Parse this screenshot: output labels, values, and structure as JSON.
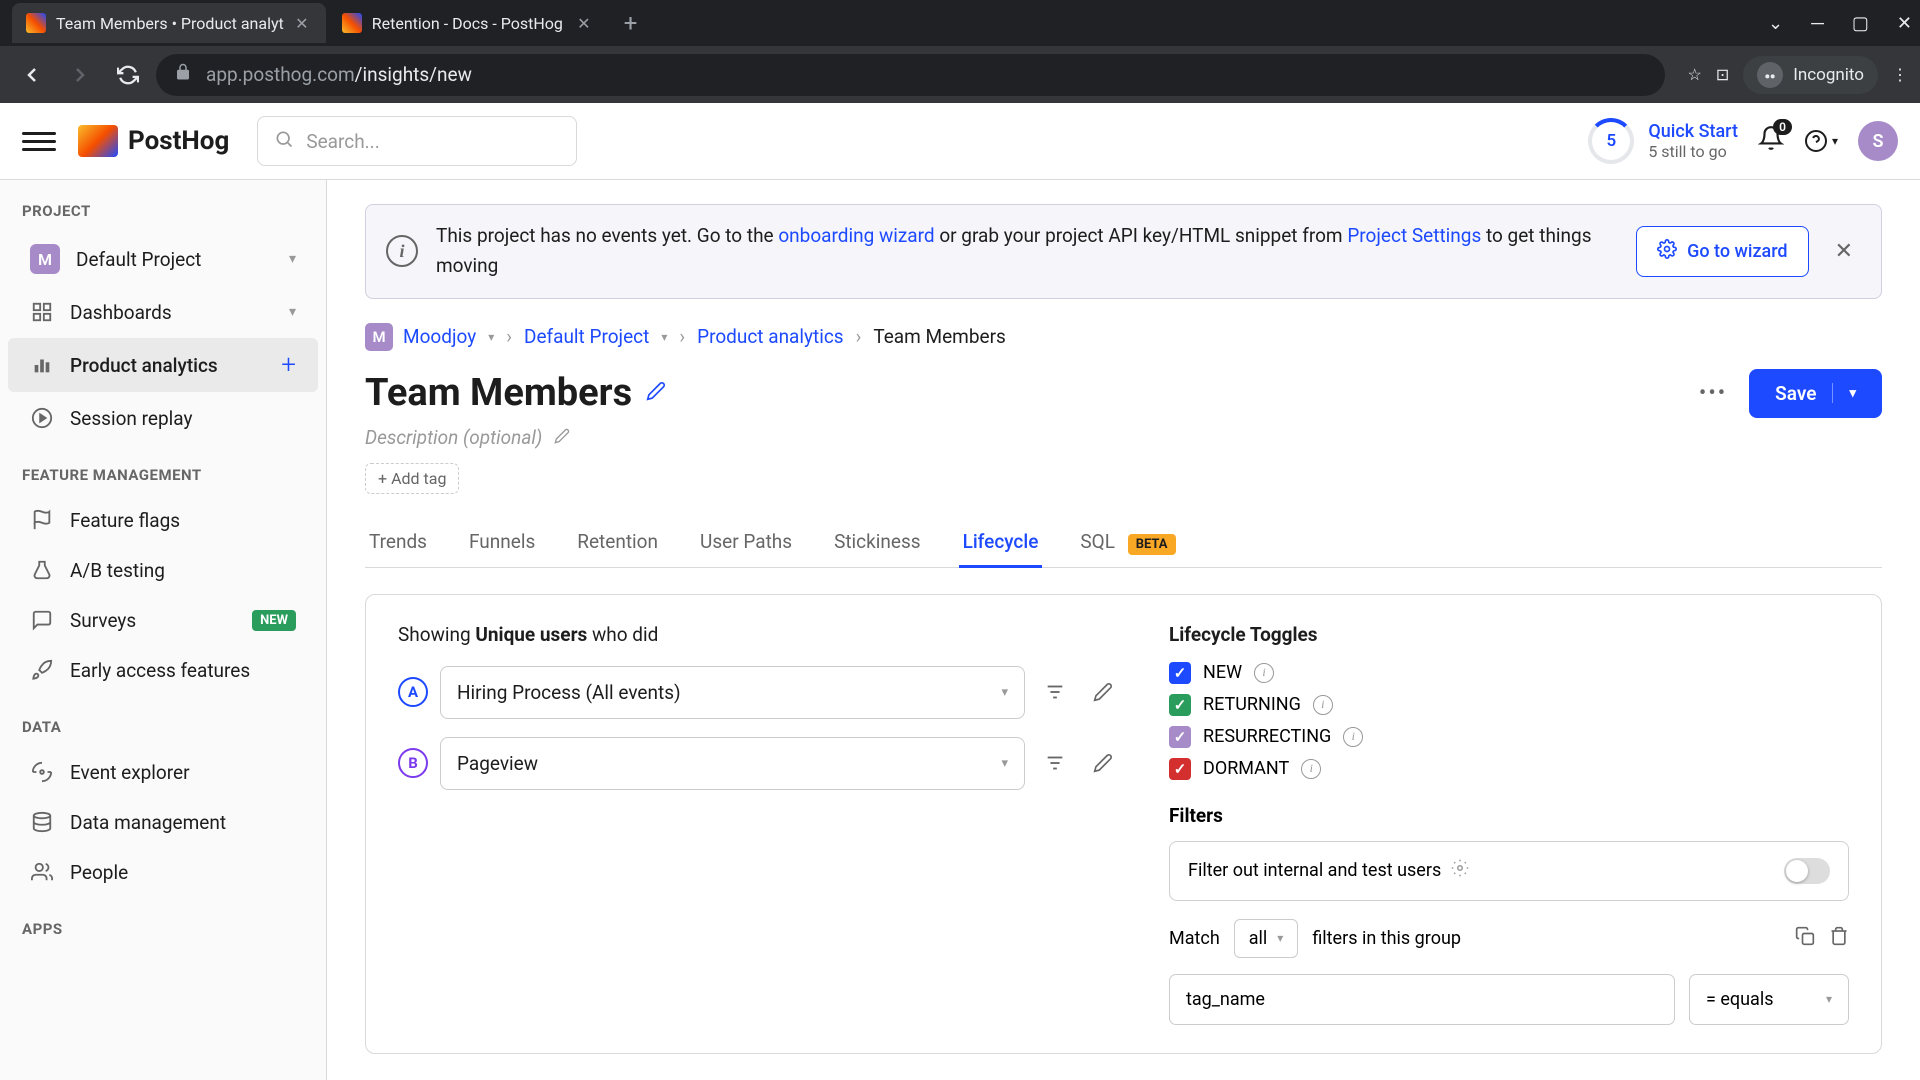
{
  "browser": {
    "tabs": [
      {
        "title": "Team Members • Product analyt",
        "active": true
      },
      {
        "title": "Retention - Docs - PostHog",
        "active": false
      }
    ],
    "url_host": "app.posthog.com",
    "url_path": "/insights/new",
    "incognito_label": "Incognito"
  },
  "header": {
    "logo_text": "PostHog",
    "search_placeholder": "Search...",
    "quick_start_title": "Quick Start",
    "quick_start_sub": "5 still to go",
    "quick_start_count": "5",
    "notif_count": "0",
    "avatar_initial": "S"
  },
  "sidebar": {
    "sections": {
      "project": "PROJECT",
      "feature_mgmt": "FEATURE MANAGEMENT",
      "data": "DATA",
      "apps": "APPS"
    },
    "default_project_initial": "M",
    "items": {
      "default_project": "Default Project",
      "dashboards": "Dashboards",
      "product_analytics": "Product analytics",
      "session_replay": "Session replay",
      "feature_flags": "Feature flags",
      "ab_testing": "A/B testing",
      "surveys": "Surveys",
      "surveys_badge": "NEW",
      "early_access": "Early access features",
      "event_explorer": "Event explorer",
      "data_management": "Data management",
      "people": "People"
    }
  },
  "banner": {
    "text_1": "This project has no events yet. Go to the ",
    "link_1": "onboarding wizard",
    "text_2": " or grab your project API key/HTML snippet from ",
    "link_2": "Project Settings",
    "text_3": " to get things moving",
    "button": "Go to wizard"
  },
  "breadcrumb": {
    "org": "Moodjoy",
    "project": "Default Project",
    "section": "Product analytics",
    "current": "Team Members",
    "org_initial": "M"
  },
  "page": {
    "title": "Team Members",
    "description_placeholder": "Description (optional)",
    "add_tag": "Add tag",
    "save": "Save"
  },
  "tabs": {
    "trends": "Trends",
    "funnels": "Funnels",
    "retention": "Retention",
    "user_paths": "User Paths",
    "stickiness": "Stickiness",
    "lifecycle": "Lifecycle",
    "sql": "SQL",
    "beta": "BETA"
  },
  "query": {
    "showing_1": "Showing ",
    "showing_bold": "Unique users",
    "showing_2": " who did",
    "series": [
      {
        "letter": "A",
        "label": "Hiring Process (All events)"
      },
      {
        "letter": "B",
        "label": "Pageview"
      }
    ]
  },
  "lifecycle": {
    "title": "Lifecycle Toggles",
    "new": "NEW",
    "returning": "RETURNING",
    "resurrecting": "RESURRECTING",
    "dormant": "DORMANT"
  },
  "filters": {
    "title": "Filters",
    "internal_label": "Filter out internal and test users",
    "match_label_1": "Match",
    "match_value": "all",
    "match_label_2": "filters in this group",
    "prop": "tag_name",
    "op": "= equals"
  }
}
